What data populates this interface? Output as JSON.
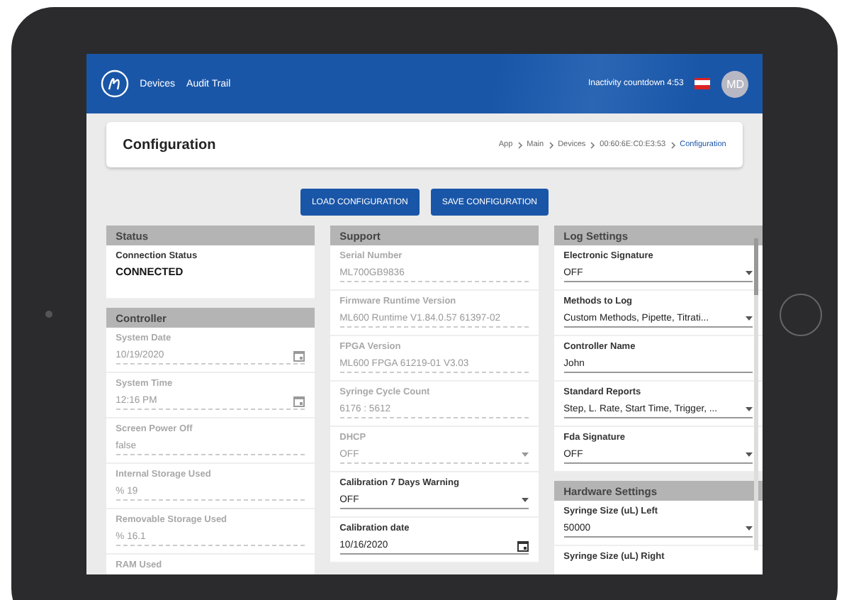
{
  "nav": {
    "links": [
      "Devices",
      "Audit Trail"
    ],
    "countdown": "Inactivity countdown 4:53",
    "avatar": "MD"
  },
  "page": {
    "title": "Configuration",
    "breadcrumb": [
      {
        "label": "App",
        "selected": false
      },
      {
        "label": "Main",
        "selected": false
      },
      {
        "label": "Devices",
        "selected": false
      },
      {
        "label": "00:60:6E:C0:E3:53",
        "selected": false
      },
      {
        "label": "Configuration",
        "selected": true
      }
    ]
  },
  "buttons": [
    "LOAD CONFIGURATION",
    "SAVE CONFIGURATION"
  ],
  "columns": [
    {
      "sections": [
        {
          "title": "Status",
          "fields": [
            {
              "kind": "status",
              "label": "Connection Status",
              "value": "CONNECTED"
            }
          ]
        },
        {
          "title": "Controller",
          "fields": [
            {
              "kind": "date",
              "label": "System Date",
              "value": "10/19/2020",
              "disabled": true
            },
            {
              "kind": "date",
              "label": "System Time",
              "value": "12:16 PM",
              "disabled": true
            },
            {
              "kind": "text",
              "label": "Screen Power Off",
              "value": "false",
              "disabled": true
            },
            {
              "kind": "text",
              "label": "Internal Storage Used",
              "value": "%  19",
              "disabled": true
            },
            {
              "kind": "text",
              "label": "Removable Storage Used",
              "value": "%  16.1",
              "disabled": true
            },
            {
              "kind": "text",
              "label": "RAM Used",
              "disabled": true
            }
          ]
        }
      ]
    },
    {
      "sections": [
        {
          "title": "Support",
          "fields": [
            {
              "kind": "text",
              "label": "Serial Number",
              "value": "ML700GB9836",
              "disabled": true
            },
            {
              "kind": "text",
              "label": "Firmware Runtime Version",
              "value": "ML600 Runtime V1.84.0.57 61397-02",
              "disabled": true
            },
            {
              "kind": "text",
              "label": "FPGA Version",
              "value": "ML600 FPGA 61219-01 V3.03",
              "disabled": true
            },
            {
              "kind": "text",
              "label": "Syringe Cycle Count",
              "value": "6176 : 5612",
              "disabled": true
            },
            {
              "kind": "select",
              "label": "DHCP",
              "value": "OFF",
              "disabled": true
            },
            {
              "kind": "select",
              "label": "Calibration 7 Days Warning",
              "value": "OFF",
              "disabled": false
            },
            {
              "kind": "date",
              "label": "Calibration date",
              "value": "10/16/2020",
              "disabled": false
            }
          ]
        }
      ]
    },
    {
      "sections": [
        {
          "title": "Log Settings",
          "fields": [
            {
              "kind": "select",
              "label": "Electronic Signature",
              "value": "OFF",
              "disabled": false
            },
            {
              "kind": "select",
              "label": "Methods to Log",
              "value": "Custom Methods, Pipette, Titrati...",
              "disabled": false
            },
            {
              "kind": "text",
              "label": "Controller Name",
              "value": "John",
              "disabled": false
            },
            {
              "kind": "select",
              "label": "Standard Reports",
              "value": "Step, L. Rate, Start Time, Trigger, ...",
              "disabled": false
            },
            {
              "kind": "select",
              "label": "Fda Signature",
              "value": "OFF",
              "disabled": false
            }
          ]
        },
        {
          "title": "Hardware Settings",
          "fields": [
            {
              "kind": "select",
              "label": "Syringe Size (uL) Left",
              "value": "50000",
              "disabled": false
            },
            {
              "kind": "text",
              "label": "Syringe Size (uL) Right",
              "disabled": false
            }
          ]
        }
      ]
    }
  ]
}
